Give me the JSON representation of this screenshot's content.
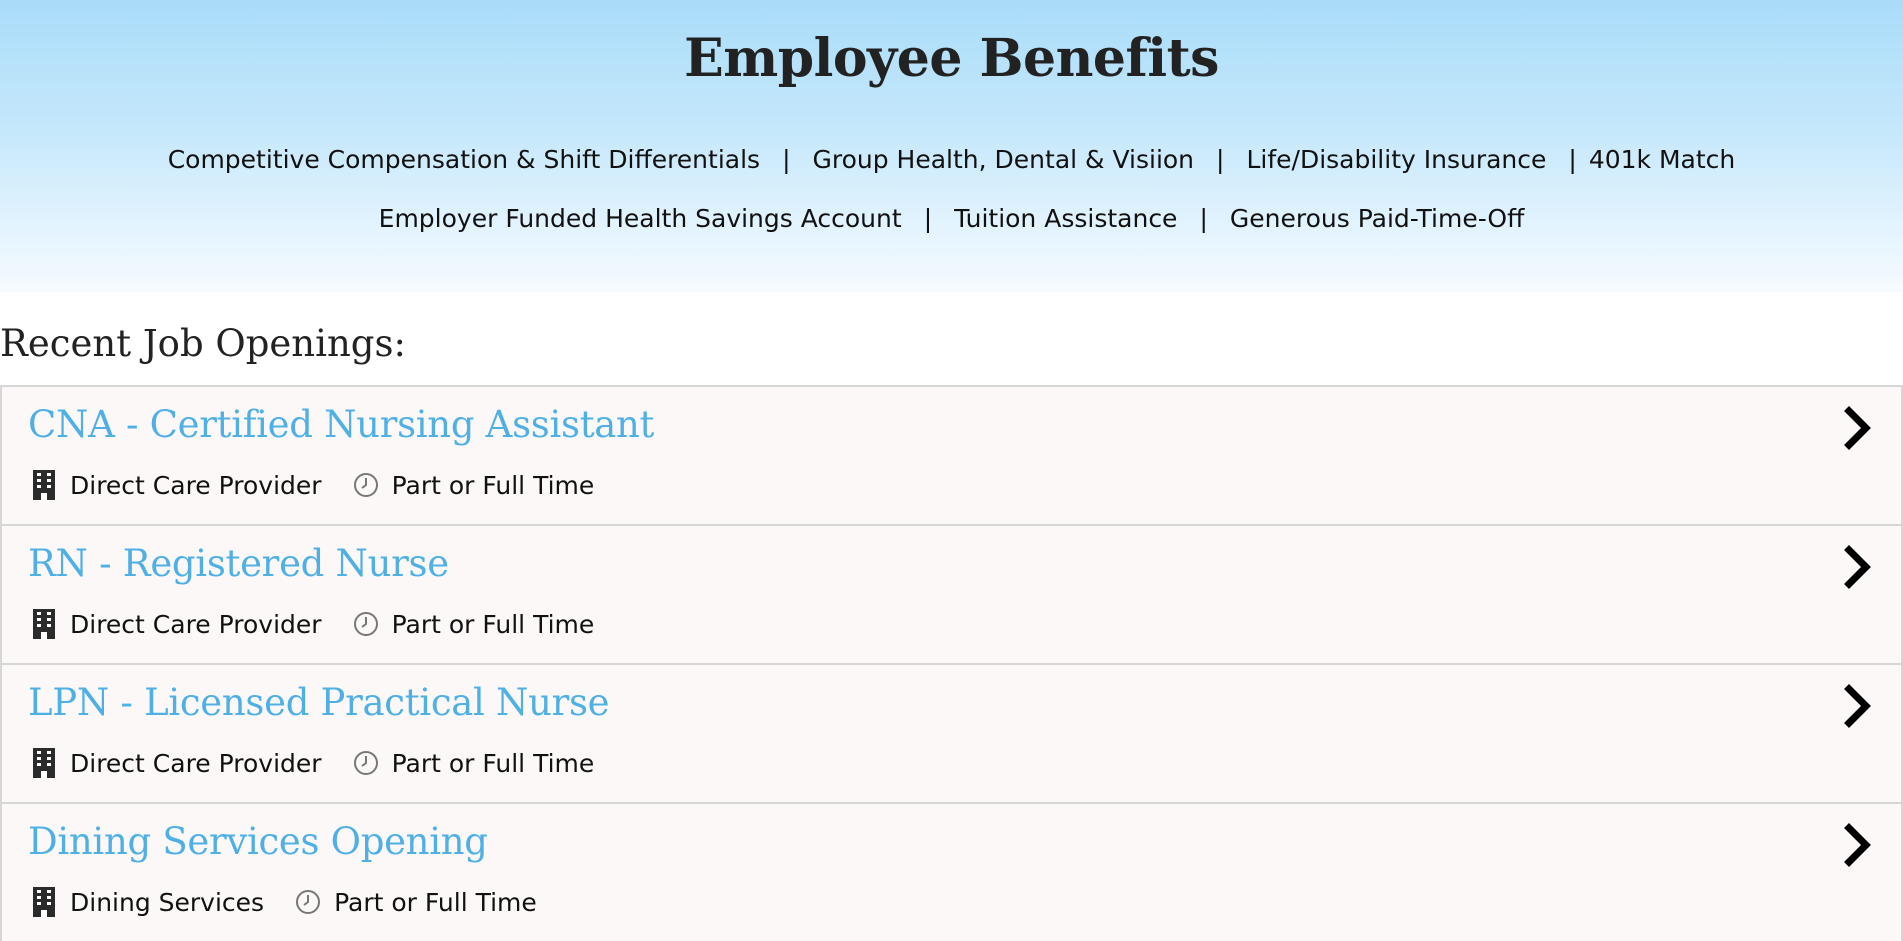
{
  "benefits": {
    "title": "Employee Benefits",
    "line1": [
      "Competitive Compensation & Shift Differentials",
      "Group Health, Dental & Visiion",
      "Life/Disability Insurance",
      "401k Match"
    ],
    "line2": [
      "Employer Funded Health Savings Account",
      "Tuition Assistance",
      "Generous Paid-Time-Off"
    ],
    "separator": "|"
  },
  "openings": {
    "heading": "Recent Job Openings:",
    "jobs": [
      {
        "title": "CNA - Certified Nursing Assistant",
        "department": "Direct Care Provider",
        "schedule": "Part or Full Time"
      },
      {
        "title": "RN - Registered Nurse",
        "department": "Direct Care Provider",
        "schedule": "Part or Full Time"
      },
      {
        "title": "LPN - Licensed Practical Nurse",
        "department": "Direct Care Provider",
        "schedule": "Part or Full Time"
      },
      {
        "title": "Dining Services Opening",
        "department": "Dining Services",
        "schedule": "Part or Full Time"
      }
    ]
  },
  "icons": {
    "department": "building-icon",
    "schedule": "clock-icon",
    "open": "chevron-right-icon"
  },
  "colors": {
    "job_title": "#4fb0e6",
    "header_gradient_top": "#a9dcf9",
    "header_gradient_bottom": "#f6fbff",
    "row_background": "#fdf8f8"
  }
}
